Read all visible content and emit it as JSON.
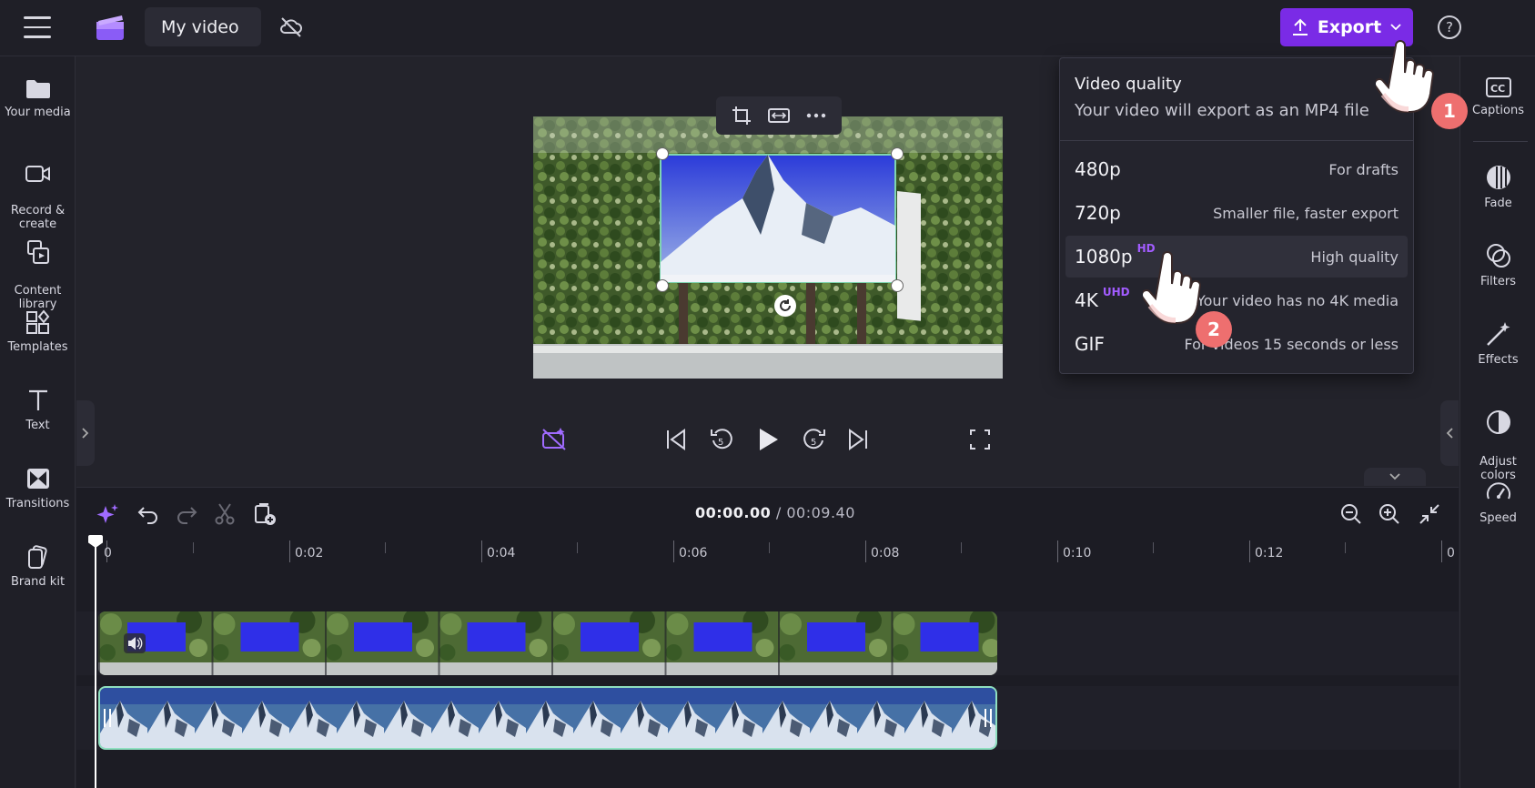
{
  "app": {
    "project_title": "My video"
  },
  "toolbar": {
    "export_label": "Export",
    "help_label": "?"
  },
  "left_nav": [
    {
      "label": "Your media",
      "icon": "folder-icon"
    },
    {
      "label": "Record &\ncreate",
      "icon": "camera-icon"
    },
    {
      "label": "Content\nlibrary",
      "icon": "library-icon"
    },
    {
      "label": "Templates",
      "icon": "templates-icon"
    },
    {
      "label": "Text",
      "icon": "text-icon"
    },
    {
      "label": "Transitions",
      "icon": "transitions-icon"
    },
    {
      "label": "Brand kit",
      "icon": "brand-kit-icon"
    }
  ],
  "right_nav": [
    {
      "label": "Captions",
      "icon": "captions-icon"
    },
    {
      "label": "Fade",
      "icon": "fade-icon"
    },
    {
      "label": "Filters",
      "icon": "filters-icon"
    },
    {
      "label": "Effects",
      "icon": "effects-icon"
    },
    {
      "label": "Adjust\ncolors",
      "icon": "adjust-colors-icon"
    },
    {
      "label": "Speed",
      "icon": "speed-icon"
    }
  ],
  "timeline": {
    "current_time": "00:00.00",
    "total_time": " / 00:09.40",
    "ticks": [
      "0",
      "0:02",
      "0:04",
      "0:06",
      "0:08",
      "0:10",
      "0:12",
      "0"
    ]
  },
  "export_menu": {
    "title": "Video quality",
    "subtitle": "Your video will export as an MP4 file",
    "options": [
      {
        "quality": "480p",
        "badge": "",
        "desc": "For drafts"
      },
      {
        "quality": "720p",
        "badge": "",
        "desc": "Smaller file, faster export"
      },
      {
        "quality": "1080p",
        "badge": "HD",
        "desc": "High quality"
      },
      {
        "quality": "4K",
        "badge": "UHD",
        "desc": "Your video has no 4K media"
      },
      {
        "quality": "GIF",
        "badge": "",
        "desc": "For videos 15 seconds or less"
      }
    ]
  },
  "annotations": {
    "step1": "1",
    "step2": "2"
  },
  "colors": {
    "accent": "#7a2be6",
    "badge": "#a25cff",
    "step": "#ee6f6f"
  }
}
